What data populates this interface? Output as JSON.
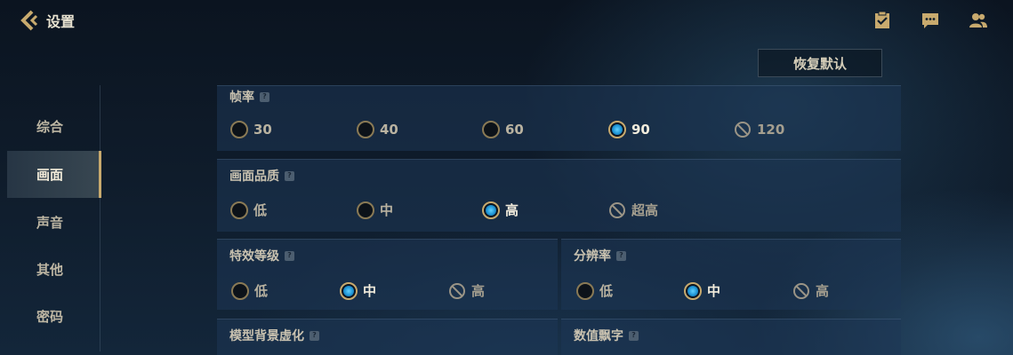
{
  "header": {
    "title": "设置",
    "icons": [
      "back-chevron-icon",
      "checklist-icon",
      "chat-icon",
      "friends-icon"
    ]
  },
  "reset_label": "恢复默认",
  "sidebar": {
    "items": [
      {
        "label": "综合"
      },
      {
        "label": "画面",
        "active": true
      },
      {
        "label": "声音"
      },
      {
        "label": "其他"
      },
      {
        "label": "密码"
      }
    ]
  },
  "settings": {
    "framerate": {
      "title": "帧率",
      "options": [
        {
          "label": "30",
          "state": "unselected"
        },
        {
          "label": "40",
          "state": "unselected"
        },
        {
          "label": "60",
          "state": "unselected"
        },
        {
          "label": "90",
          "state": "selected"
        },
        {
          "label": "120",
          "state": "disabled"
        }
      ]
    },
    "quality": {
      "title": "画面品质",
      "options": [
        {
          "label": "低",
          "state": "unselected"
        },
        {
          "label": "中",
          "state": "unselected"
        },
        {
          "label": "高",
          "state": "selected"
        },
        {
          "label": "超高",
          "state": "disabled"
        }
      ]
    },
    "effects": {
      "title": "特效等级",
      "options": [
        {
          "label": "低",
          "state": "unselected"
        },
        {
          "label": "中",
          "state": "selected"
        },
        {
          "label": "高",
          "state": "disabled"
        }
      ]
    },
    "resolution": {
      "title": "分辨率",
      "options": [
        {
          "label": "低",
          "state": "unselected"
        },
        {
          "label": "中",
          "state": "selected"
        },
        {
          "label": "高",
          "state": "disabled"
        }
      ]
    },
    "model_bg_blur": {
      "title": "模型背景虚化"
    },
    "damage_numbers": {
      "title": "数值飘字"
    }
  },
  "help_glyph": "?",
  "colors": {
    "accent_gold": "#c8aa6e",
    "selected_blue": "#1a8fd0",
    "panel_bg": "#1e3755"
  }
}
